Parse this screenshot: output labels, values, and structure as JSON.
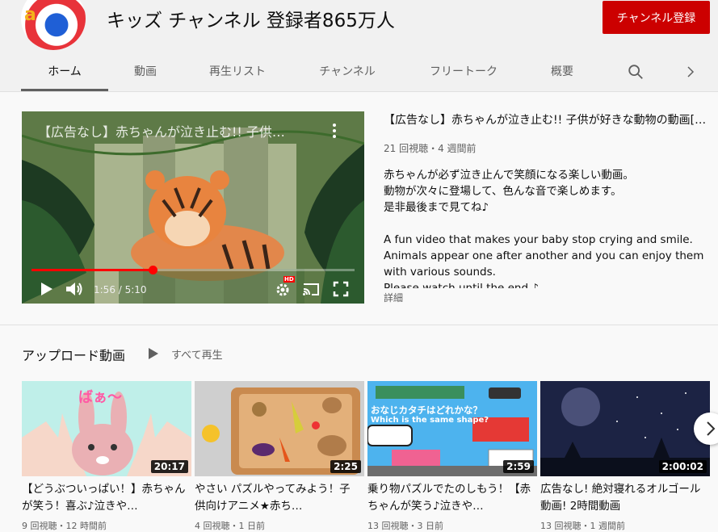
{
  "channel": {
    "title": "キッズ チャンネル 登録者865万人",
    "subscribe_label": "チャンネル登録",
    "avatar_letter": "a"
  },
  "tabs": [
    {
      "label": "ホーム",
      "active": true
    },
    {
      "label": "動画"
    },
    {
      "label": "再生リスト"
    },
    {
      "label": "チャンネル"
    },
    {
      "label": "フリートーク"
    },
    {
      "label": "概要"
    }
  ],
  "icons": {
    "search": "search-icon",
    "tabs_next": "chevron-right-icon"
  },
  "featured": {
    "player_title": "【広告なし】赤ちゃんが泣き止む!! 子供…",
    "current_time": "1:56 / 5:10",
    "progress": 0.375,
    "title": "【広告なし】赤ちゃんが泣き止む!! 子供が好きな動物の動画[…",
    "meta": "21 回視聴・4 週間前",
    "description": [
      "赤ちゃんが必ず泣き止んで笑顔になる楽しい動画。",
      "動物が次々に登場して、色んな音で楽しめます。",
      "是非最後まで見てね♪",
      "",
      "A fun video that makes your baby stop crying and smile.",
      "Animals appear one after another and you can enjoy them with various sounds.",
      "Please watch until the end ♪"
    ],
    "more_label": "詳細",
    "hd_badge": "HD"
  },
  "shelf": {
    "title": "アップロード動画",
    "play_all_label": "すべて再生",
    "items": [
      {
        "title": "【どうぶついっぱい！】赤ちゃんが笑う！喜ぶ♪泣きや…",
        "duration": "20:17",
        "meta": "9 回視聴・12 時間前",
        "thumb_text": "ばぁ〜"
      },
      {
        "title": "やさい パズルやってみよう！子供向けアニメ★赤ち…",
        "duration": "2:25",
        "meta": "4 回視聴・1 日前"
      },
      {
        "title": "乗り物パズルでたのしもう！【赤ちゃんが笑う♪泣きや…",
        "duration": "2:59",
        "meta": "13 回視聴・3 日前",
        "thumb_text": "おなじカタチはどれかな？",
        "thumb_subtext": "Which is the same shape?"
      },
      {
        "title": "広告なし! 絶対寝れるオルゴール動画! 2時間動画",
        "duration": "2:00:02",
        "meta": "13 回視聴・1 週間前"
      }
    ]
  },
  "colors": {
    "subscribe": "#cc0000",
    "progress": "#ff0000",
    "background": "#f9f9f9",
    "header": "#f1f1f1"
  }
}
